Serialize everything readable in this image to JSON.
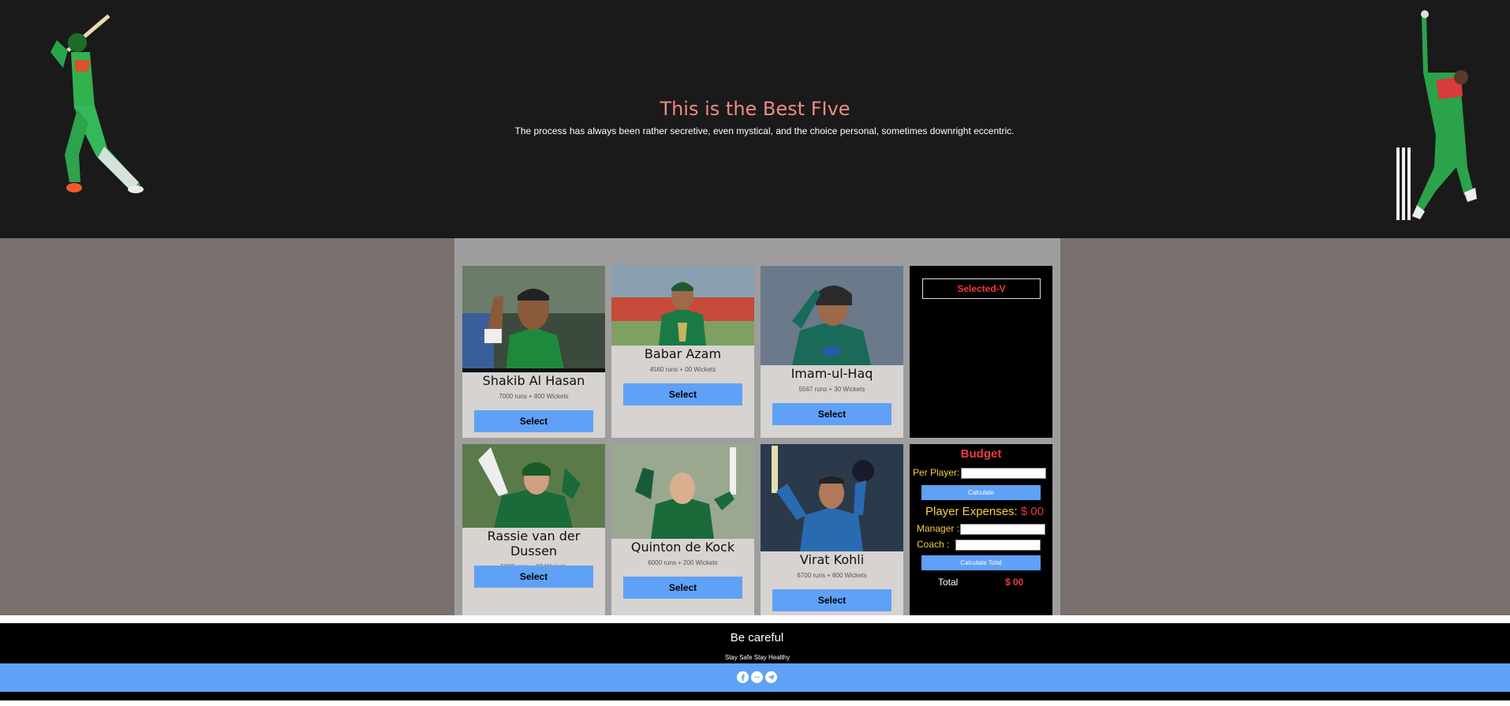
{
  "header": {
    "title": "This is the Best FIve",
    "subtitle": "The process has always been rather secretive, even mystical, and the choice personal, sometimes downright eccentric."
  },
  "players": [
    {
      "name": "Shakib Al Hasan",
      "stats": "7000 runs + 800 Wickets",
      "select_label": "Select"
    },
    {
      "name": "Babar Azam",
      "stats": "4560 runs + 00 Wickets",
      "select_label": "Select"
    },
    {
      "name": "Imam-ul-Haq",
      "stats": "5567 runs + 30 Wickets",
      "select_label": "Select"
    },
    {
      "name": "Rassie van der Dussen",
      "stats": "5000 runs + 00 Wickets",
      "select_label": "Select"
    },
    {
      "name": "Quinton de Kock",
      "stats": "6000 runs + 200 Wickets",
      "select_label": "Select"
    },
    {
      "name": "Virat Kohli",
      "stats": "6700 runs + 800 Wickets",
      "select_label": "Select"
    }
  ],
  "selected_panel": {
    "title": "Selected-V"
  },
  "budget": {
    "title": "Budget",
    "per_player_label": "Per Player:",
    "per_player_value": "",
    "calculate_label": "Calculate",
    "player_expenses_label": "Player Expenses:",
    "player_expenses_value": "$ 00",
    "manager_label": "Manager :",
    "manager_value": "",
    "coach_label": "Coach :",
    "coach_value": "",
    "calculate_total_label": "Calculate Total",
    "total_label": "Total",
    "total_value": "$ 00"
  },
  "footer": {
    "title": "Be careful",
    "subtitle": "Stay Safe Stay Healthy",
    "icons": [
      "facebook-icon",
      "messenger-icon",
      "telegram-icon"
    ]
  },
  "colors": {
    "header_bg": "#1a1a1a",
    "title": "#f08a80",
    "accent_blue": "#5fa1f6",
    "red": "#f03a3a",
    "yellow": "#f5d142"
  }
}
